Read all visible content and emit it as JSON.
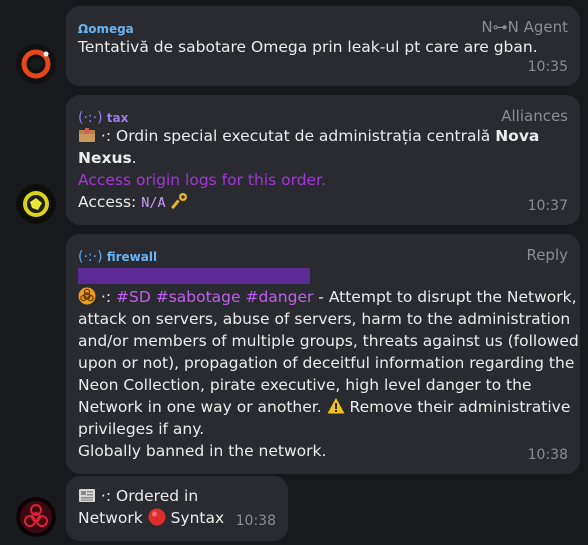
{
  "messages": [
    {
      "sender": "Ωomega",
      "tag": "N⊶N  Agent",
      "text": "Tentativă de sabotare Omega prin leak-ul pt care are gban.",
      "time": "10:35"
    },
    {
      "sender": "tax",
      "tag": "Alliances",
      "line1_prefix": " ·: Ordin special executat de administrația centrală ",
      "line1_bold": "Nova",
      "line2_bold": "Nexus",
      "line2_suffix": ".",
      "link": "Access origin logs for this order.",
      "access_label": " Access:  ",
      "access_value": "N/A",
      "time": "10:37"
    },
    {
      "sender": "firewall",
      "tag": "Reply",
      "line1_mid": " ·: ",
      "hashtags": "#SD #sabotage #danger",
      "line1_rest": " - Attempt to disrupt the Network,",
      "line2": "attack on servers, abuse of servers, harm to the administration",
      "line3": "and/or members of multiple groups, threats against us (followed",
      "line4": "upon or not), propagation of deceitful information regarding the",
      "line5": "Neon Collection, pirate executive, high level danger to the",
      "line6_a": "Network in one way or another. ",
      "line6_b": " Remove their administrative",
      "line7": "privileges if any.",
      "line8": "Globally banned in the network.",
      "time": "10:38"
    },
    {
      "line1": " ·: Ordered in",
      "line2_a": "Network ",
      "line2_b": " Syntax",
      "time": "10:38"
    }
  ],
  "colors": {
    "background": "#18191d",
    "bubble": "#2a2b31",
    "sender": "#6ab3f3",
    "hashtag": "#c05ff0",
    "link": "#a335d6"
  },
  "icons": [
    "omega-avatar-icon",
    "tax-avatar-icon",
    "biohazard-avatar-icon",
    "package-icon",
    "key-icon",
    "biohazard-icon",
    "warning-icon",
    "newspaper-icon",
    "red-circle-icon"
  ]
}
